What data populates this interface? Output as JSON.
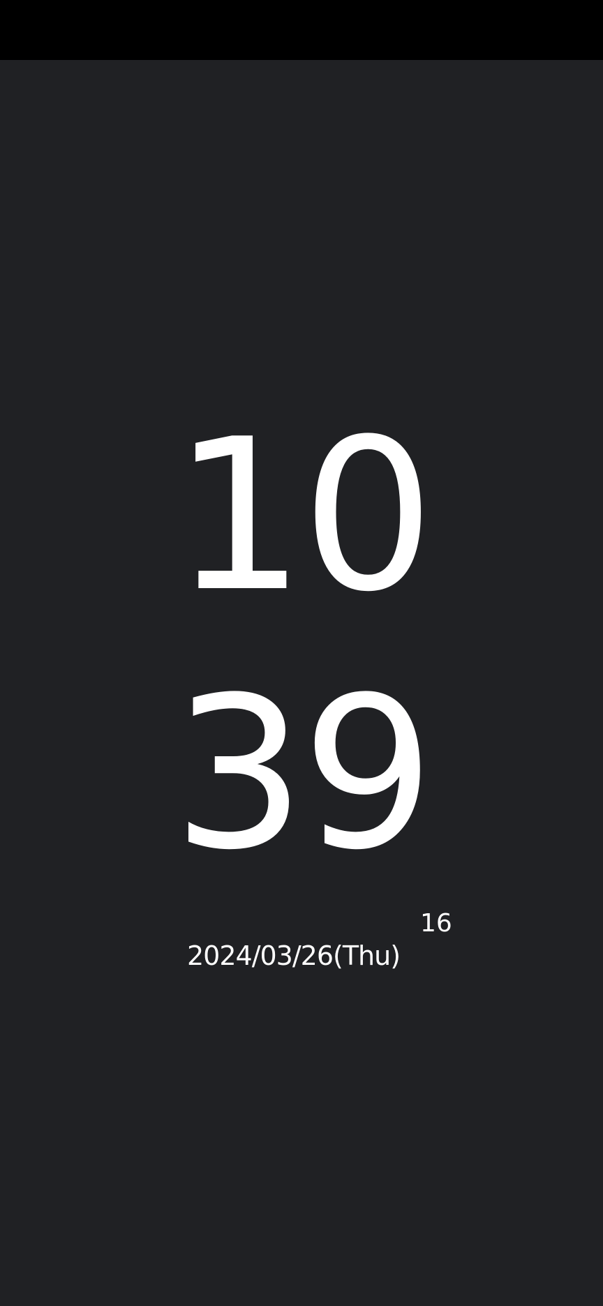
{
  "clock": {
    "hours": "10",
    "minutes": "39",
    "seconds": "16",
    "date": "2024/03/26(Thu)"
  },
  "colors": {
    "background": "#202124",
    "status_bar": "#000000",
    "text": "#ffffff"
  }
}
